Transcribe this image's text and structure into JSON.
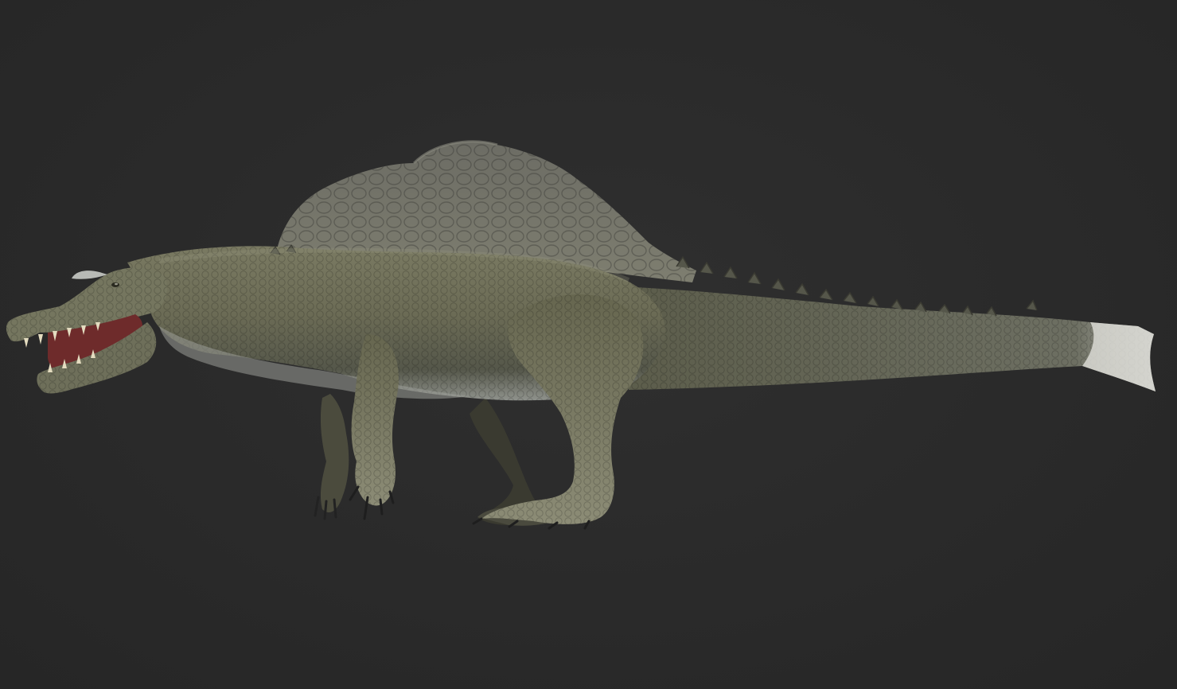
{
  "scene": {
    "background_color": "#2a2a2a",
    "subject": "spinosaurus-3d-model",
    "palette": {
      "skin_main": "#6b6b55",
      "skin_dark": "#3f3f33",
      "skin_light": "#8a8a72",
      "belly": "#9a9c98",
      "sail": "#74746a",
      "sail_dark": "#4e4e46",
      "mouth": "#6e2b2b",
      "teeth": "#e4dcc0",
      "tail_fin": "#d9d9d4"
    }
  }
}
